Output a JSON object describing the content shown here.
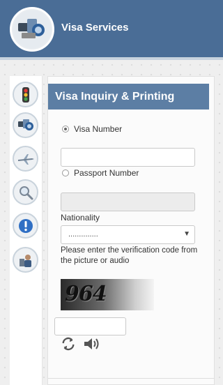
{
  "header": {
    "title": "Visa Services"
  },
  "sidebar": {
    "items": [
      {
        "name": "traffic-light-icon"
      },
      {
        "name": "passports-icon"
      },
      {
        "name": "airplane-icon"
      },
      {
        "name": "magnifier-icon"
      },
      {
        "name": "info-exclamation-icon"
      },
      {
        "name": "person-icon"
      }
    ]
  },
  "form": {
    "title": "Visa Inquiry & Printing",
    "option_visa": "Visa Number",
    "option_passport": "Passport Number",
    "visa_number_value": "",
    "passport_number_value": "",
    "nationality_label": "Nationality",
    "nationality_selected": "..............",
    "verification_hint": "Please enter the verification code from the picture or audio",
    "captcha_code": "964",
    "captcha_value": ""
  },
  "colors": {
    "header_bg": "#4a6d96",
    "panel_title_bg": "#5c7ea4"
  }
}
